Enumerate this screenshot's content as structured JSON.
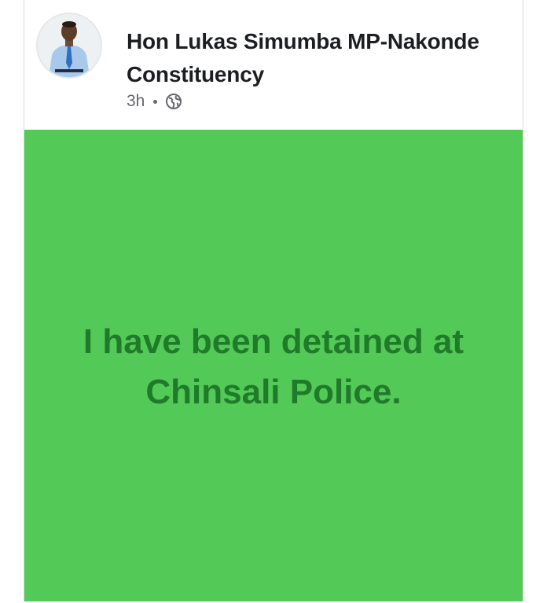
{
  "post": {
    "author": "Hon Lukas Simumba MP-Nakonde Constituency",
    "timestamp": "3h",
    "audience_icon": "globe-icon",
    "text": "I have been detained at Chinsali Police.",
    "background_color": "#53c957",
    "text_color": "#1f7a2a"
  }
}
